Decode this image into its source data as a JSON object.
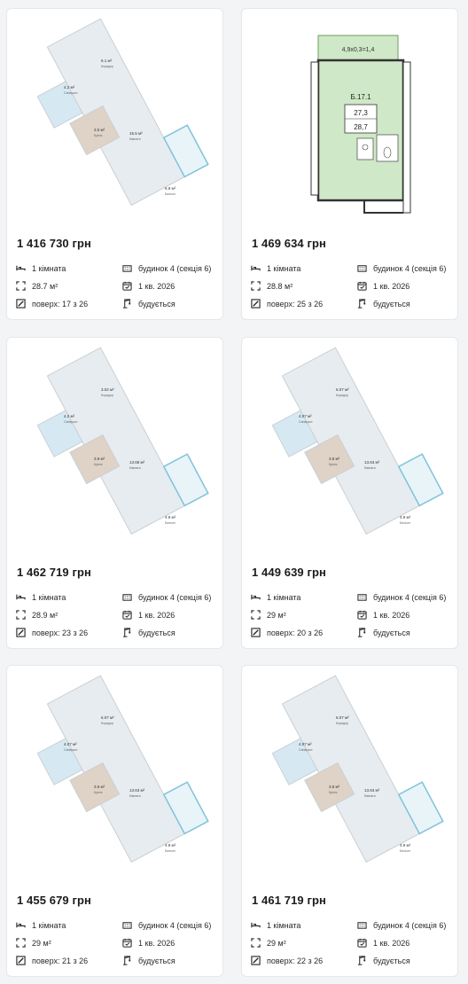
{
  "listings": [
    {
      "price": "1 416 730 грн",
      "rooms": "1 кімната",
      "building": "будинок 4 (секція 6)",
      "area": "28.7 м²",
      "completion": "1 кв. 2026",
      "floor": "поверх: 17 з 26",
      "status": "будується",
      "plan": {
        "corridor": "6.1 м²",
        "corridor_label": "Коридор",
        "bath": "4.2 м²",
        "bath_label": "Санвузол",
        "kitchen": "3.5 м²",
        "kitchen_label": "Кухня",
        "living": "15.5 м²",
        "living_label": "Кімната",
        "balcony": "6.9 м²",
        "balcony_label": "Балкон"
      }
    },
    {
      "price": "1 469 634 грн",
      "rooms": "1 кімната",
      "building": "будинок 4 (секція 6)",
      "area": "28.8 м²",
      "completion": "1 кв. 2026",
      "floor": "поверх: 25 з 26",
      "status": "будується",
      "plan": {
        "balcony_dims": "4,9х0,3=1,4",
        "unit": "Б.17.1",
        "area_a": "27,3",
        "area_b": "28,7"
      }
    },
    {
      "price": "1 462 719 грн",
      "rooms": "1 кімната",
      "building": "будинок 4 (секція 6)",
      "area": "28.9 м²",
      "completion": "1 кв. 2026",
      "floor": "поверх: 23 з 26",
      "status": "будується",
      "plan": {
        "corridor": "3.02 м²",
        "corridor_label": "Коридор",
        "bath": "4.2 м²",
        "bath_label": "Санвузол",
        "kitchen": "3.9 м²",
        "kitchen_label": "Кухня",
        "living": "13.68 м²",
        "living_label": "Кімната",
        "balcony": "4.9 м²",
        "balcony_label": "Балкон"
      }
    },
    {
      "price": "1 449 639 грн",
      "rooms": "1 кімната",
      "building": "будинок 4 (секція 6)",
      "area": "29 м²",
      "completion": "1 кв. 2026",
      "floor": "поверх: 20 з 26",
      "status": "будується",
      "plan": {
        "corridor": "6.07 м²",
        "corridor_label": "Коридор",
        "bath": "4.07 м²",
        "bath_label": "Санвузол",
        "kitchen": "3.6 м²",
        "kitchen_label": "Кухня",
        "living": "13.63 м²",
        "living_label": "Кімната",
        "balcony": "4.9 м²",
        "balcony_label": "Балкон"
      }
    },
    {
      "price": "1 455 679 грн",
      "rooms": "1 кімната",
      "building": "будинок 4 (секція 6)",
      "area": "29 м²",
      "completion": "1 кв. 2026",
      "floor": "поверх: 21 з 26",
      "status": "будується",
      "plan": {
        "corridor": "6.07 м²",
        "corridor_label": "Коридор",
        "bath": "4.07 м²",
        "bath_label": "Санвузол",
        "kitchen": "3.6 м²",
        "kitchen_label": "Кухня",
        "living": "13.63 м²",
        "living_label": "Кімната",
        "balcony": "4.9 м²",
        "balcony_label": "Балкон"
      }
    },
    {
      "price": "1 461 719 грн",
      "rooms": "1 кімната",
      "building": "будинок 4 (секція 6)",
      "area": "29 м²",
      "completion": "1 кв. 2026",
      "floor": "поверх: 22 з 26",
      "status": "будується",
      "plan": {
        "corridor": "6.07 м²",
        "corridor_label": "Коридор",
        "bath": "4.07 м²",
        "bath_label": "Санвузол",
        "kitchen": "3.6 м²",
        "kitchen_label": "Кухня",
        "living": "13.63 м²",
        "living_label": "Кімната",
        "balcony": "4.9 м²",
        "balcony_label": "Балкон"
      }
    }
  ],
  "icons": {
    "rooms": "bed-icon",
    "building": "building-icon",
    "area": "area-icon",
    "completion": "calendar-icon",
    "floor": "floor-icon",
    "status": "crane-icon"
  },
  "colors": {
    "room_fill": "#e6ecef",
    "bath_fill": "#d6e9f2",
    "kitchen_fill": "#dfd2c6",
    "balcony_fill": "#e9f4f8",
    "balcony_stroke": "#7ec3dc",
    "green_fill": "#cfe8c7"
  }
}
